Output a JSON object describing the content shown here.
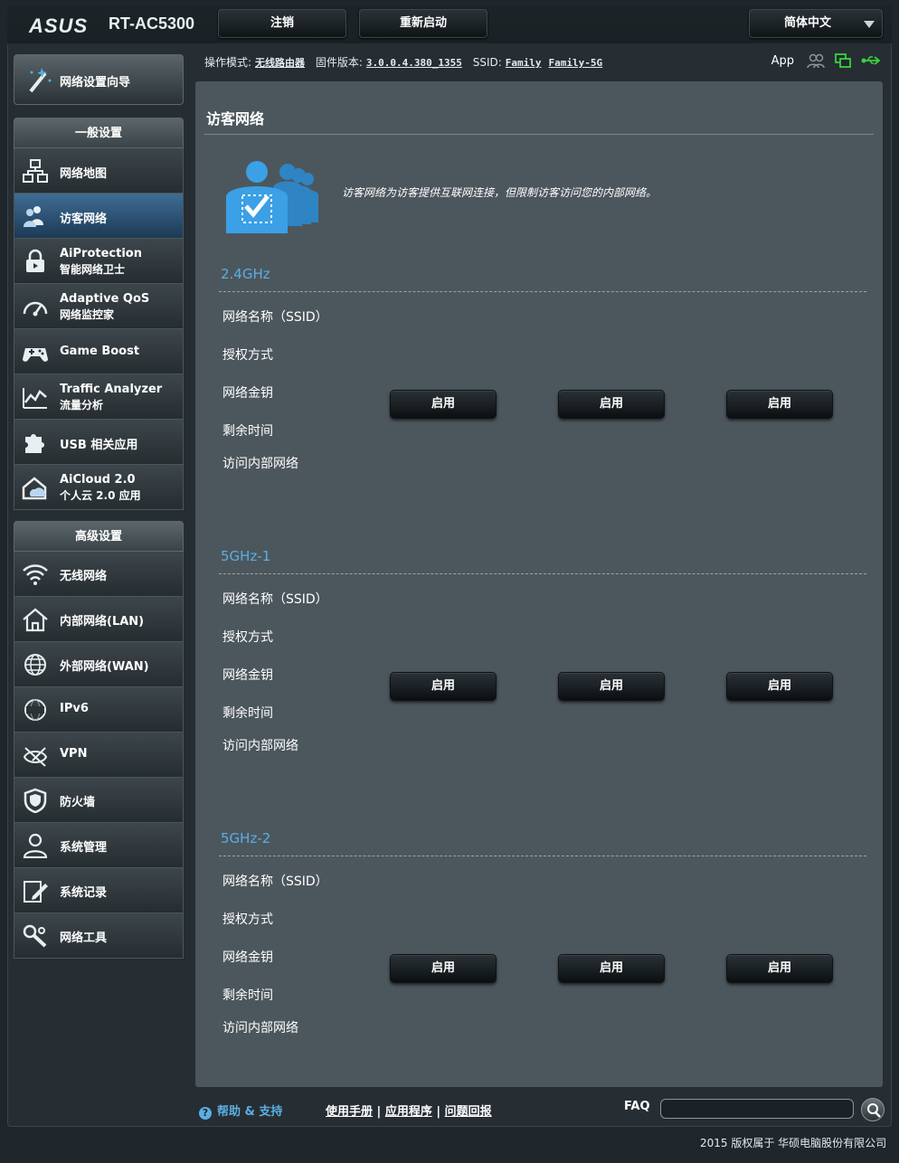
{
  "header": {
    "brand": "ASUS",
    "model": "RT-AC5300",
    "logout_label": "注销",
    "reboot_label": "重新启动",
    "language": "简体中文"
  },
  "status": {
    "mode_label": "操作模式:",
    "mode_value": "无线路由器",
    "firmware_label": "固件版本:",
    "firmware_value": "3.0.0.4.380_1355",
    "ssid_label": "SSID:",
    "ssid_values": [
      "Family",
      "Family-5G"
    ],
    "app_label": "App"
  },
  "sidebar": {
    "wizard_label": "网络设置向导",
    "general_title": "一般设置",
    "general_items": [
      {
        "t1": "网络地图",
        "t2": "",
        "icon": "network-map-icon"
      },
      {
        "t1": "访客网络",
        "t2": "",
        "icon": "guest-network-icon",
        "active": true
      },
      {
        "t1": "AiProtection",
        "t2": "智能网络卫士",
        "icon": "lock-icon"
      },
      {
        "t1": "Adaptive QoS",
        "t2": "网络监控家",
        "icon": "gauge-icon"
      },
      {
        "t1": "Game Boost",
        "t2": "",
        "icon": "gamepad-icon"
      },
      {
        "t1": "Traffic Analyzer",
        "t2": "流量分析",
        "icon": "chart-icon"
      },
      {
        "t1": "USB 相关应用",
        "t2": "",
        "icon": "puzzle-icon"
      },
      {
        "t1": "AiCloud 2.0",
        "t2": "个人云 2.0 应用",
        "icon": "cloud-home-icon"
      }
    ],
    "advanced_title": "高级设置",
    "advanced_items": [
      {
        "t1": "无线网络",
        "icon": "wifi-icon"
      },
      {
        "t1": "内部网络(LAN)",
        "icon": "home-icon"
      },
      {
        "t1": "外部网络(WAN)",
        "icon": "globe-icon"
      },
      {
        "t1": "IPv6",
        "icon": "ipv6-icon"
      },
      {
        "t1": "VPN",
        "icon": "vpn-icon"
      },
      {
        "t1": "防火墙",
        "icon": "shield-icon"
      },
      {
        "t1": "系统管理",
        "icon": "admin-user-icon"
      },
      {
        "t1": "系统记录",
        "icon": "log-edit-icon"
      },
      {
        "t1": "网络工具",
        "icon": "tools-icon"
      }
    ]
  },
  "main": {
    "title": "访客网络",
    "intro": "访客网络为访客提供互联网连接，但限制访客访问您的内部网络。",
    "row_labels": [
      "网络名称（SSID）",
      "授权方式",
      "网络金钥",
      "剩余时间",
      "访问内部网络"
    ],
    "enable_label": "启用",
    "bands": [
      {
        "title": "2.4GHz"
      },
      {
        "title": "5GHz-1"
      },
      {
        "title": "5GHz-2"
      }
    ]
  },
  "footer": {
    "help_label": "帮助 & 支持",
    "links": [
      "使用手册",
      "应用程序",
      "问题回报"
    ],
    "faq_label": "FAQ",
    "copyright": "2015 版权属于 华硕电脑股份有限公司"
  },
  "colors": {
    "accent": "#5aaee3",
    "panel": "#4c575d",
    "status_green": "#3bd13b"
  }
}
